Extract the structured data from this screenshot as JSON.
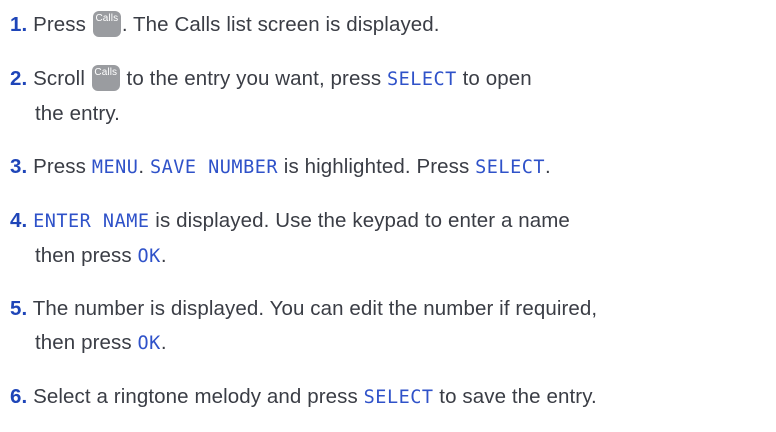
{
  "key_icon": {
    "label": "Calls",
    "glyph": "chevron-down"
  },
  "colors": {
    "number": "#1e45b8",
    "lcd_text": "#2f52c9",
    "body_text": "#3a3d45",
    "key_bg": "#9a9ca0"
  },
  "steps": [
    {
      "number": "1",
      "dot": ".",
      "t1": " Press ",
      "t2": ". The Calls list screen is displayed."
    },
    {
      "number": "2",
      "dot": ".",
      "t1": " Scroll ",
      "t2": " to the entry you want, press ",
      "lcd1": "SELECT",
      "t3": " to open",
      "t4": "the entry."
    },
    {
      "number": "3",
      "dot": ".",
      "t1": " Press ",
      "lcd1": "MENU",
      "t2": ". ",
      "lcd2": "SAVE NUMBER",
      "t3": " is highlighted. Press ",
      "lcd3": "SELECT",
      "t4": "."
    },
    {
      "number": "4",
      "dot": ".",
      "lcd1": "ENTER NAME",
      "t1": " is displayed. Use the keypad to enter a name",
      "t2": "then press ",
      "lcd2": "OK",
      "t3": "."
    },
    {
      "number": "5",
      "dot": ".",
      "t1": " The number is displayed. You can edit the number if required,",
      "t2": "then press ",
      "lcd1": "OK",
      "t3": "."
    },
    {
      "number": "6",
      "dot": ".",
      "t1": " Select a ringtone melody and press ",
      "lcd1": "SELECT",
      "t2": " to save the entry."
    }
  ]
}
